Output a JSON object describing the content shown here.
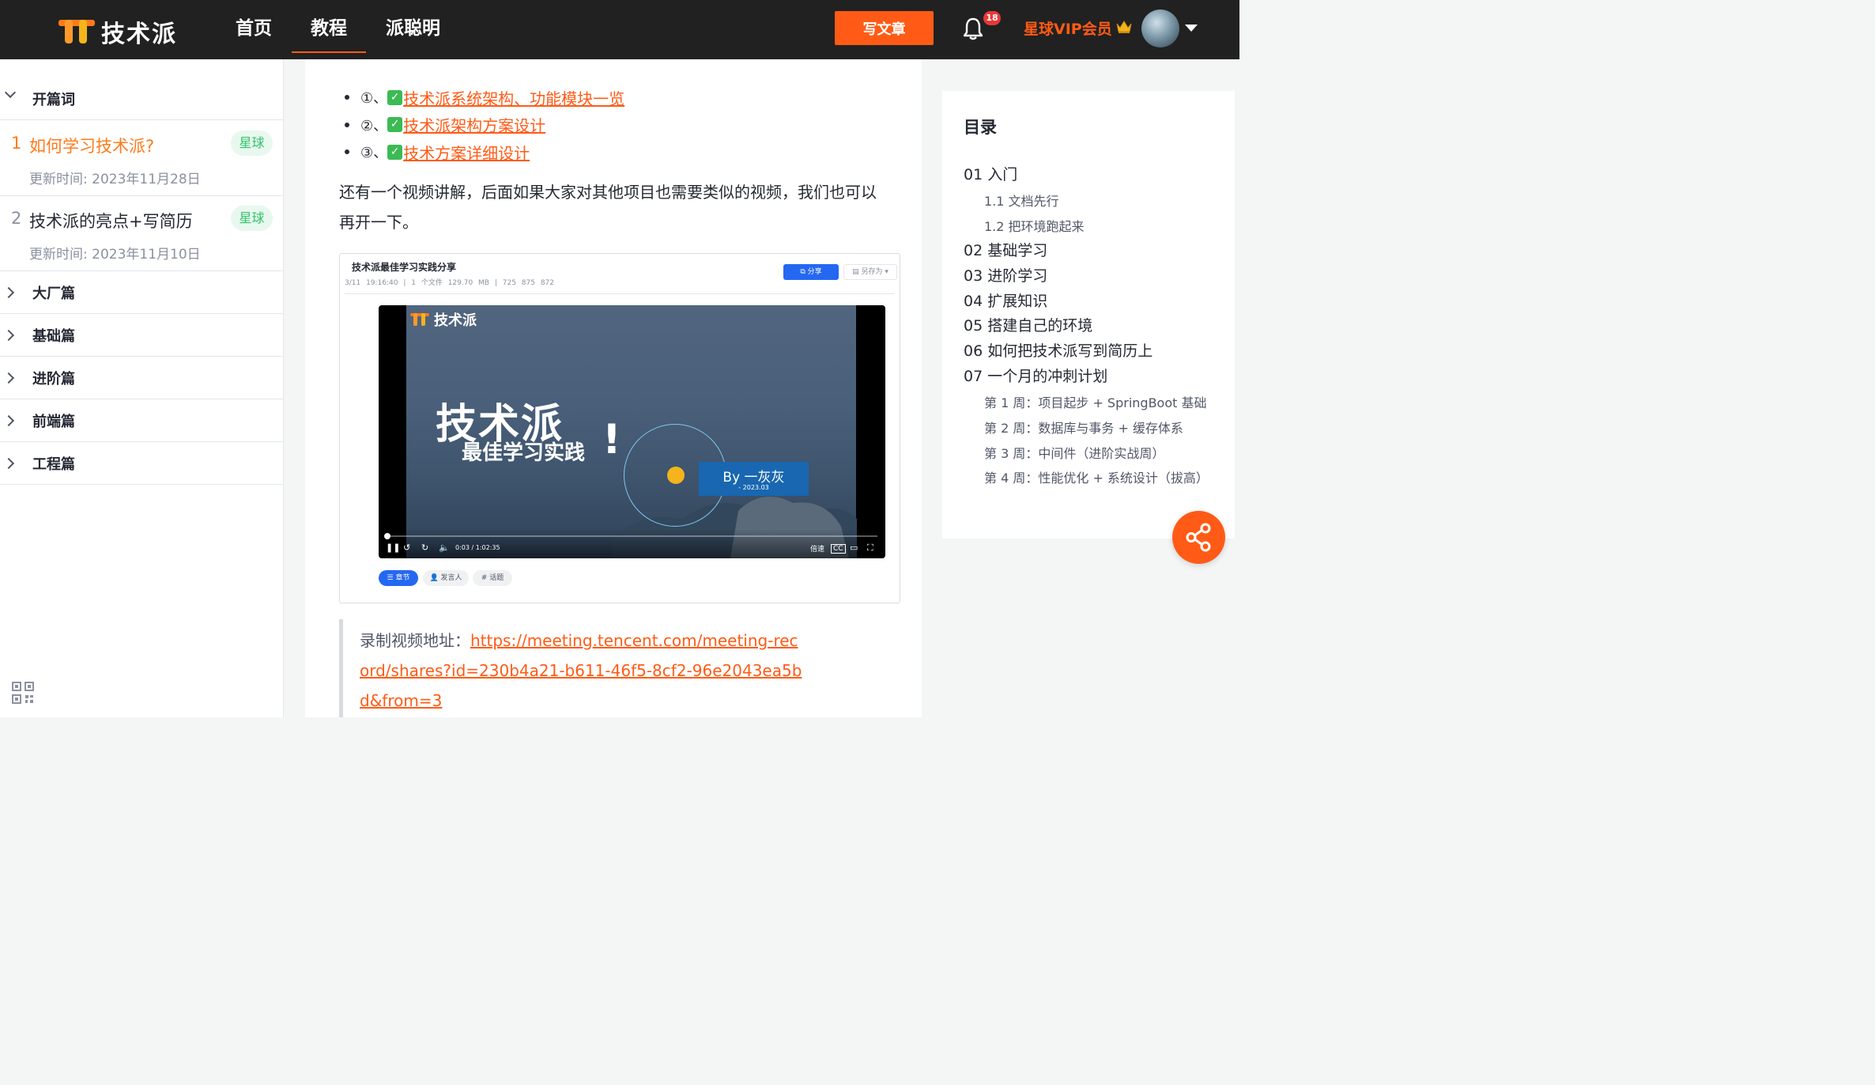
{
  "header": {
    "logo_text": "技术派",
    "nav": [
      {
        "label": "首页",
        "active": false
      },
      {
        "label": "教程",
        "active": true
      },
      {
        "label": "派聪明",
        "active": false
      }
    ],
    "write_button": "写文章",
    "notification_count": "18",
    "vip_label": "星球VIP会员",
    "accent_color": "#ff5b16"
  },
  "sidebar": {
    "open_section": "开篇词",
    "lessons": [
      {
        "num": "1",
        "title": "如何学习技术派?",
        "tag": "星球",
        "time": "更新时间: 2023年11月28日",
        "active": true
      },
      {
        "num": "2",
        "title": "技术派的亮点+写简历",
        "tag": "星球",
        "time": "更新时间: 2023年11月10日",
        "active": false
      }
    ],
    "sections": [
      "大厂篇",
      "基础篇",
      "进阶篇",
      "前端篇",
      "工程篇"
    ]
  },
  "article": {
    "links": [
      {
        "prefix": "①、",
        "text": "技术派系统架构、功能模块一览"
      },
      {
        "prefix": "②、",
        "text": "技术派架构方案设计"
      },
      {
        "prefix": "③、",
        "text": "技术方案详细设计"
      }
    ],
    "paragraph": "还有一个视频讲解，后面如果大家对其他项目也需要类似的视频，我们也可以再开一下。",
    "screenshot": {
      "title": "技术派最佳学习实践分享",
      "meta": "3/11 19:16:40 | 1 个文件 129.70 MB | 725 875 872",
      "share_button": "分享",
      "save_as_button": "另存为",
      "video_logo": "技术派",
      "video_title": "技术派",
      "video_subtitle": "最佳学习实践",
      "video_bang": "!",
      "video_by": "By 一灰灰",
      "video_date": "- 2023.03",
      "video_time": "0:03 / 1:02:35",
      "video_speed": "倍速",
      "progress": 0.001,
      "pills": [
        "章节",
        "发言人",
        "话题"
      ]
    },
    "quote_label": "录制视频地址：",
    "quote_link": "https://meeting.tencent.com/meeting-record/shares?id=230b4a21-b611-46f5-8cf2-96e2043ea5bd&from=3"
  },
  "toc": {
    "title": "目录",
    "items": [
      {
        "text": "01 入门",
        "level": 1
      },
      {
        "text": "1.1 文档先行",
        "level": 2
      },
      {
        "text": "1.2 把环境跑起来",
        "level": 2
      },
      {
        "text": "02 基础学习",
        "level": 1
      },
      {
        "text": "03 进阶学习",
        "level": 1
      },
      {
        "text": "04 扩展知识",
        "level": 1
      },
      {
        "text": "05 搭建自己的环境",
        "level": 1
      },
      {
        "text": "06 如何把技术派写到简历上",
        "level": 1
      },
      {
        "text": "07 一个月的冲刺计划",
        "level": 1
      },
      {
        "text": "第 1 周：项目起步 + SpringBoot 基础",
        "level": 2
      },
      {
        "text": "第 2 周：数据库与事务 + 缓存体系",
        "level": 2
      },
      {
        "text": "第 3 周：中间件（进阶实战周）",
        "level": 2
      },
      {
        "text": "第 4 周：性能优化 + 系统设计（拔高）",
        "level": 2
      }
    ]
  }
}
